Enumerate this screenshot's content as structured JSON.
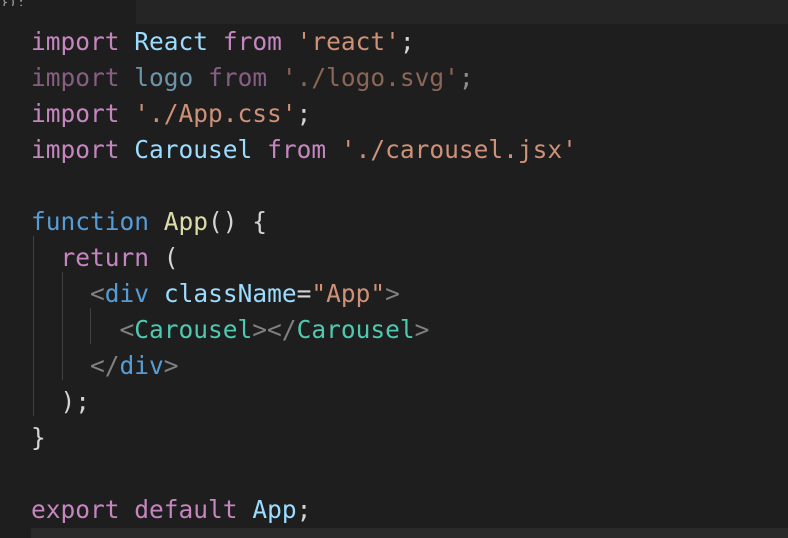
{
  "colors": {
    "background": "#1e1e1e",
    "keyword_purple": "#c586c0",
    "keyword_blue": "#569cd6",
    "identifier": "#9cdcfe",
    "string": "#ce9178",
    "function_name": "#dcdcaa",
    "component": "#4ec9b0",
    "tag_bracket": "#808080",
    "text": "#d4d4d4"
  },
  "top_fragment": "});",
  "code": {
    "line1": {
      "kw1": "import",
      "ident": "React",
      "kw2": "from",
      "str": "'react'",
      "end": ";"
    },
    "line2": {
      "kw1": "import",
      "ident": "logo",
      "kw2": "from",
      "str": "'./logo.svg'",
      "end": ";"
    },
    "line3": {
      "kw1": "import",
      "str": "'./App.css'",
      "end": ";"
    },
    "line4": {
      "kw1": "import",
      "ident": "Carousel",
      "kw2": "from",
      "str": "'./carousel.jsx'"
    },
    "line6": {
      "kw": "function",
      "fn": "App",
      "rest": "() {"
    },
    "line7": {
      "kw": "return",
      "rest": "("
    },
    "line8": {
      "open": "<",
      "tag": "div",
      "attr": "className",
      "eq": "=",
      "val": "\"App\"",
      "close": ">"
    },
    "line9": {
      "open1": "<",
      "comp1": "Carousel",
      "mid": "></",
      "comp2": "Carousel",
      "close": ">"
    },
    "line10": {
      "open": "</",
      "tag": "div",
      "close": ">"
    },
    "line11": {
      "text": ");"
    },
    "line12": {
      "text": "}"
    },
    "line14": {
      "kw1": "export",
      "kw2": "default",
      "ident": "App",
      "end": ";"
    }
  }
}
